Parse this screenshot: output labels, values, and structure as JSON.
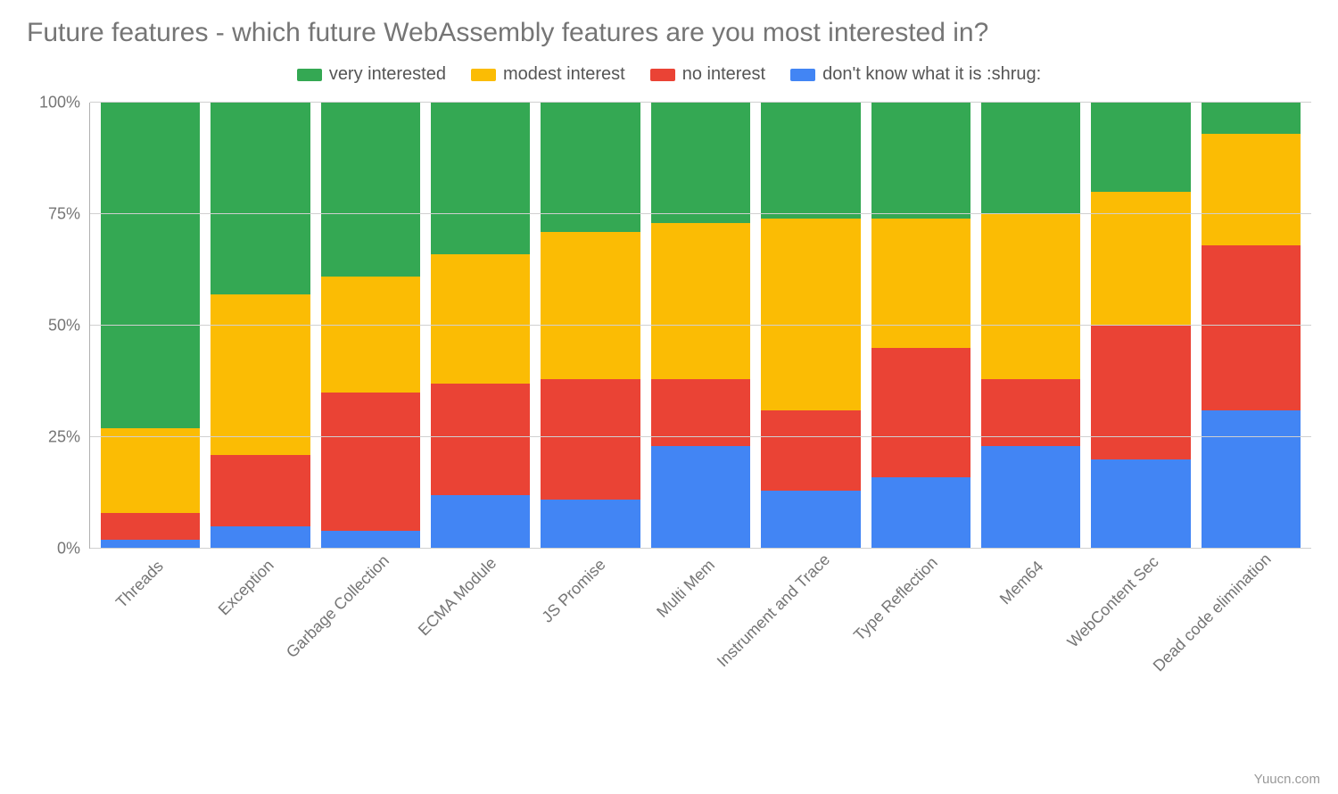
{
  "chart_data": {
    "type": "bar",
    "stacked": true,
    "percent": true,
    "title": "Future features - which future WebAssembly features are you most interested in?",
    "ylabel": "",
    "xlabel": "",
    "ylim": [
      0,
      100
    ],
    "y_ticks": [
      "0%",
      "25%",
      "50%",
      "75%",
      "100%"
    ],
    "categories": [
      "Threads",
      "Exception",
      "Garbage Collection",
      "ECMA Module",
      "JS Promise",
      "Multi Mem",
      "Instrument and Trace",
      "Type Reflection",
      "Mem64",
      "WebContent Sec",
      "Dead code elimination"
    ],
    "series": [
      {
        "name": "don't know what it is :shrug:",
        "color": "#4285F4",
        "values": [
          2,
          5,
          4,
          12,
          11,
          23,
          13,
          16,
          23,
          20,
          31
        ]
      },
      {
        "name": "no interest",
        "color": "#EA4335",
        "values": [
          6,
          16,
          31,
          25,
          27,
          15,
          18,
          29,
          15,
          30,
          37
        ]
      },
      {
        "name": "modest interest",
        "color": "#FBBC04",
        "values": [
          19,
          36,
          26,
          29,
          33,
          35,
          43,
          29,
          37,
          30,
          25
        ]
      },
      {
        "name": "very interested",
        "color": "#34A853",
        "values": [
          73,
          43,
          39,
          34,
          29,
          27,
          26,
          26,
          25,
          20,
          7
        ]
      }
    ],
    "legend_order": [
      "very interested",
      "modest interest",
      "no interest",
      "don't know what it is :shrug:"
    ]
  },
  "watermark": "Yuucn.com"
}
